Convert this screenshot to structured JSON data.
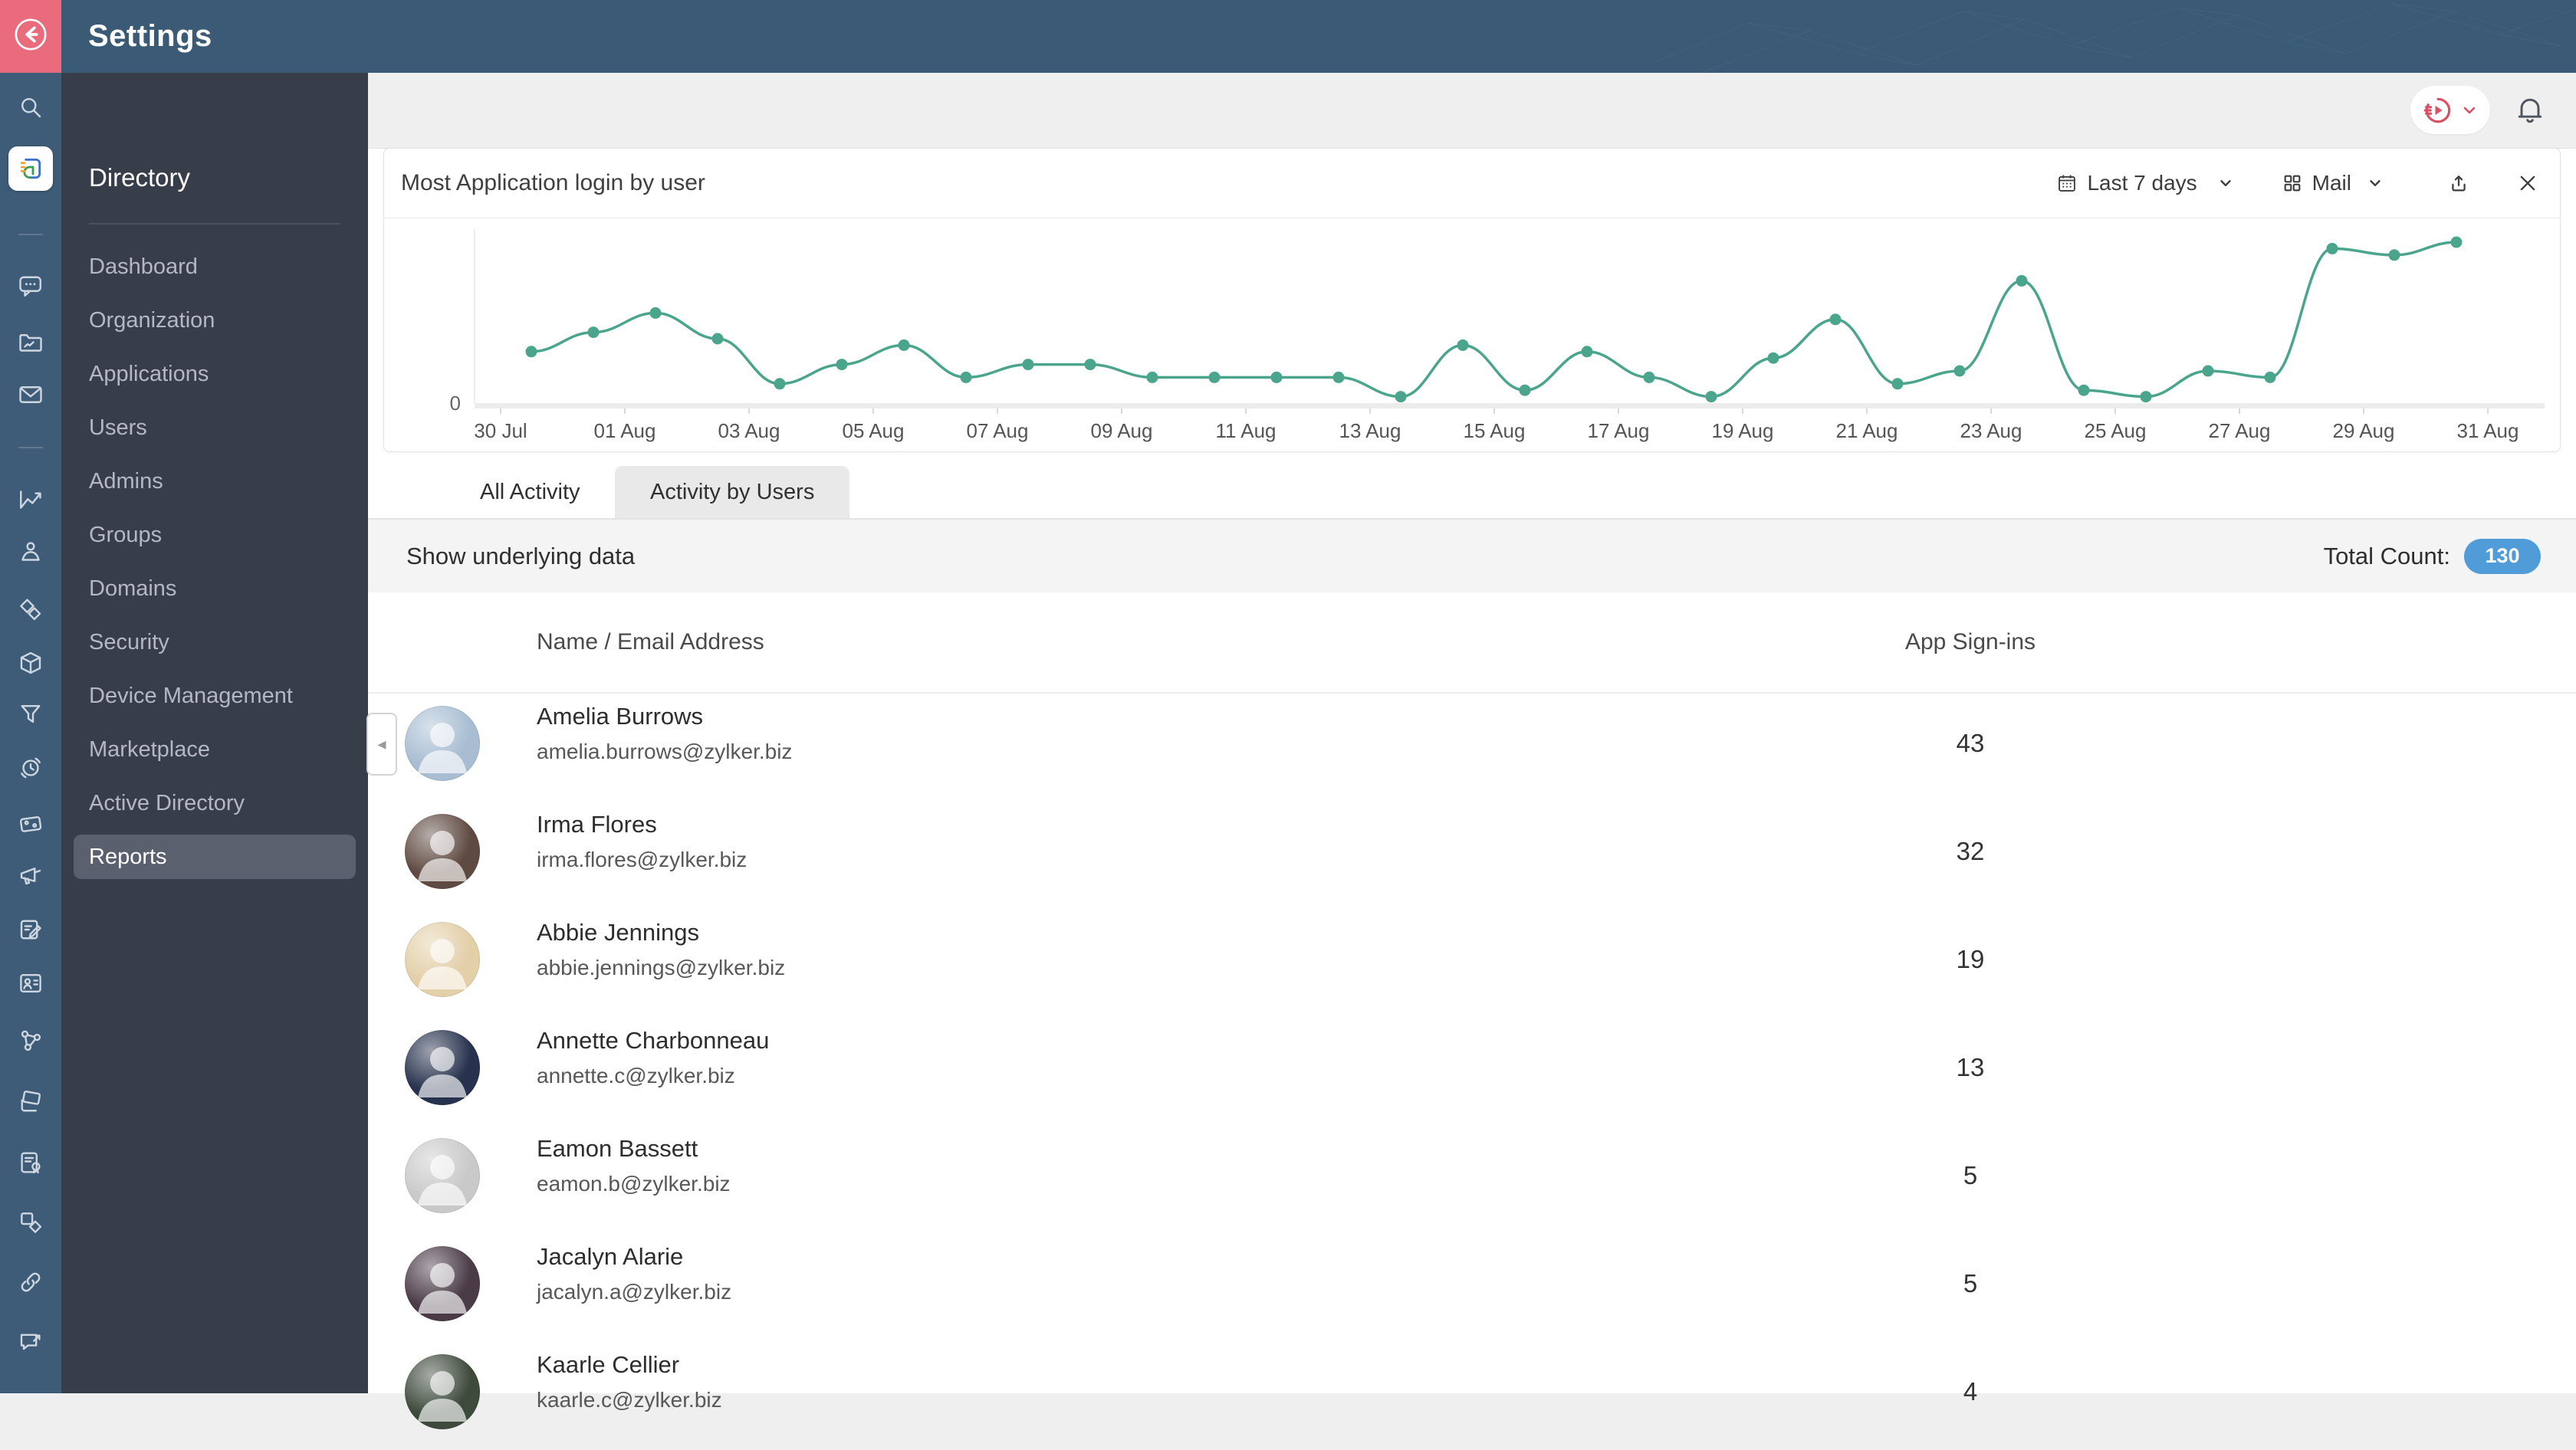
{
  "app": {
    "title": "Settings",
    "back_icon": "back-arrow-icon"
  },
  "colors": {
    "header_bg": "#3b5a75",
    "back_btn": "#e96b7c",
    "rail_bg": "#3e5c77",
    "sidebar_bg": "#383d4a",
    "selected_item_bg": "#5b606e",
    "accent_pink": "#d94f63",
    "chart_line": "#4aa58c",
    "count_pill": "#4f9cd9"
  },
  "rail": {
    "items": [
      "search-icon",
      "directory-app-icon",
      "|",
      "chat-icon",
      "reports-folder-icon",
      "mail-icon",
      "|",
      "analytics-icon",
      "people-icon",
      "assets-icon",
      "package-icon",
      "filter-icon",
      "scheduler-icon",
      "wallet-icon",
      "campaign-icon",
      "compose-icon",
      "contacts-icon",
      "network-icon",
      "layers-icon",
      "document-badge-icon",
      "shapes-icon",
      "link-icon",
      "feedback-icon"
    ]
  },
  "sidebar": {
    "heading": "Directory",
    "items": [
      "Dashboard",
      "Organization",
      "Applications",
      "Users",
      "Admins",
      "Groups",
      "Domains",
      "Security",
      "Device Management",
      "Marketplace",
      "Active Directory",
      "Reports"
    ],
    "selected": "Reports"
  },
  "topbar": {
    "org_switcher_icon": "org-avatar-icon",
    "bell_icon": "bell-icon"
  },
  "widget": {
    "title": "Most Application login by user",
    "range_icon": "calendar-icon",
    "range_label": "Last 7 days",
    "app_filter_icon": "app-grid-icon",
    "app_filter_label": "Mail",
    "export_icon": "export-icon",
    "close_icon": "close-icon"
  },
  "chart_data": {
    "type": "line",
    "title": "Most Application login by user",
    "x": [
      "31 Jul",
      "01 Aug",
      "02 Aug",
      "03 Aug",
      "04 Aug",
      "05 Aug",
      "06 Aug",
      "07 Aug",
      "08 Aug",
      "09 Aug",
      "10 Aug",
      "11 Aug",
      "12 Aug",
      "13 Aug",
      "14 Aug",
      "15 Aug",
      "16 Aug",
      "17 Aug",
      "18 Aug",
      "19 Aug",
      "20 Aug",
      "21 Aug",
      "22 Aug",
      "23 Aug",
      "24 Aug",
      "25 Aug",
      "26 Aug",
      "27 Aug",
      "28 Aug",
      "29 Aug",
      "30 Aug",
      "31 Aug"
    ],
    "values": [
      8,
      11,
      14,
      10,
      3,
      6,
      9,
      4,
      6,
      6,
      4,
      4,
      4,
      4,
      1,
      9,
      2,
      8,
      4,
      1,
      7,
      13,
      3,
      5,
      19,
      2,
      1,
      5,
      4,
      24,
      23,
      25
    ],
    "x_ticks": [
      "30 Jul",
      "01 Aug",
      "03 Aug",
      "05 Aug",
      "07 Aug",
      "09 Aug",
      "11 Aug",
      "13 Aug",
      "15 Aug",
      "17 Aug",
      "19 Aug",
      "21 Aug",
      "23 Aug",
      "25 Aug",
      "27 Aug",
      "29 Aug",
      "31 Aug"
    ],
    "y_zero_label": "0",
    "ylim": [
      0,
      26
    ],
    "grid": false,
    "legend": "none",
    "line_color": "#4aa58c"
  },
  "tabs": [
    {
      "label": "All Activity",
      "active": false
    },
    {
      "label": "Activity by Users",
      "active": true
    }
  ],
  "underlying": {
    "heading": "Show underlying data",
    "total_label": "Total Count:",
    "total_count": "130"
  },
  "table": {
    "columns": [
      "Name / Email Address",
      "App Sign-ins"
    ],
    "rows": [
      {
        "name": "Amelia Burrows",
        "email": "amelia.burrows@zylker.biz",
        "signins": "43",
        "avatar_color": "#a8bdd2"
      },
      {
        "name": "Irma Flores",
        "email": "irma.flores@zylker.biz",
        "signins": "32",
        "avatar_color": "#5f4a42"
      },
      {
        "name": "Abbie Jennings",
        "email": "abbie.jennings@zylker.biz",
        "signins": "19",
        "avatar_color": "#e3cfa8"
      },
      {
        "name": "Annette Charbonneau",
        "email": "annette.c@zylker.biz",
        "signins": "13",
        "avatar_color": "#27324e"
      },
      {
        "name": "Eamon Bassett",
        "email": "eamon.b@zylker.biz",
        "signins": "5",
        "avatar_color": "#c9c9c9"
      },
      {
        "name": "Jacalyn Alarie",
        "email": "jacalyn.a@zylker.biz",
        "signins": "5",
        "avatar_color": "#4a3b47"
      },
      {
        "name": "Kaarle Cellier",
        "email": "kaarle.c@zylker.biz",
        "signins": "4",
        "avatar_color": "#3e4a3c"
      }
    ]
  }
}
